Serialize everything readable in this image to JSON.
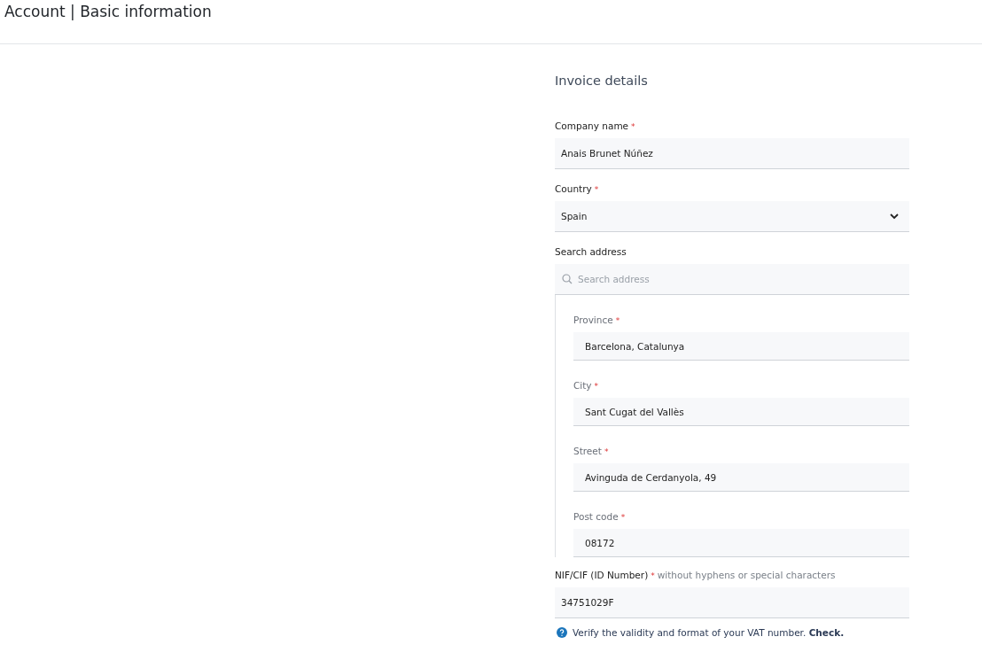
{
  "page": {
    "title": "Account | Basic information"
  },
  "section": {
    "title": "Invoice details"
  },
  "fields": [
    {
      "kind": "text",
      "label": "Company name",
      "required_mark": "*",
      "value": "Anais Brunet Núñez"
    },
    {
      "kind": "select",
      "label": "Country",
      "required_mark": "*",
      "value": "Spain"
    },
    {
      "kind": "search",
      "label": "Search address",
      "placeholder": "Search address"
    }
  ],
  "address": [
    {
      "kind": "text",
      "label": "Province",
      "required_mark": "*",
      "value": "Barcelona, Catalunya"
    },
    {
      "kind": "text",
      "label": "City",
      "required_mark": "*",
      "value": "Sant Cugat del Vallès"
    },
    {
      "kind": "text",
      "label": "Street",
      "required_mark": "*",
      "value": "Avinguda de Cerdanyola, 49"
    },
    {
      "kind": "text",
      "label": "Post code",
      "required_mark": "*",
      "value": "08172"
    }
  ],
  "id_field": {
    "label": "NIF/CIF (ID Number)",
    "required_mark": "*",
    "hint": "without hyphens or special characters",
    "value": "34751029F"
  },
  "help_note": "Verify the validity and format of your VAT number. **Check.**"
}
